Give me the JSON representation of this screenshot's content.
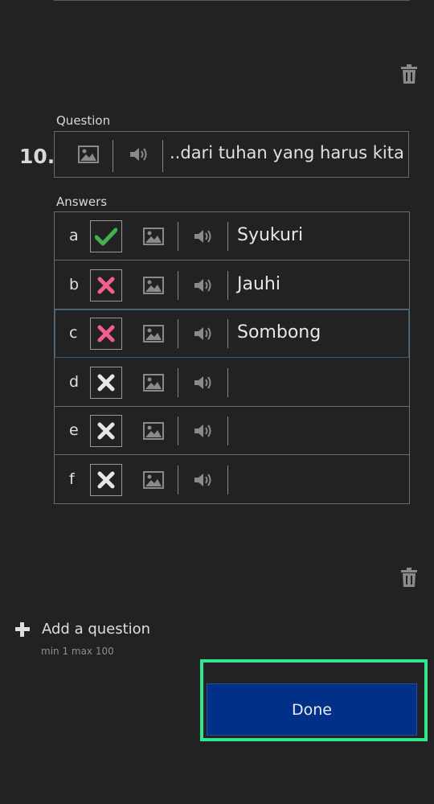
{
  "question": {
    "section_label": "Question",
    "number": "10.",
    "text": "dari tuhan yang harus kita..",
    "icons": [
      "image-icon",
      "speaker-icon"
    ]
  },
  "answers": {
    "section_label": "Answers",
    "items": [
      {
        "letter": "a",
        "text": "Syukuri",
        "status": "correct"
      },
      {
        "letter": "b",
        "text": "Jauhi",
        "status": "incorrect"
      },
      {
        "letter": "c",
        "text": "Sombong",
        "status": "incorrect"
      },
      {
        "letter": "d",
        "text": "",
        "status": "unset"
      },
      {
        "letter": "e",
        "text": "",
        "status": "unset"
      },
      {
        "letter": "f",
        "text": "",
        "status": "unset"
      }
    ]
  },
  "add_question": {
    "label": "Add a question",
    "limits": "min 1   max 100"
  },
  "done_button": {
    "label": "Done"
  },
  "colors": {
    "background": "#222222",
    "correct": "#3fb24f",
    "incorrect": "#f0608a",
    "unset": "#e6e6e6",
    "done_bg": "#003087",
    "highlight": "#32e690"
  }
}
